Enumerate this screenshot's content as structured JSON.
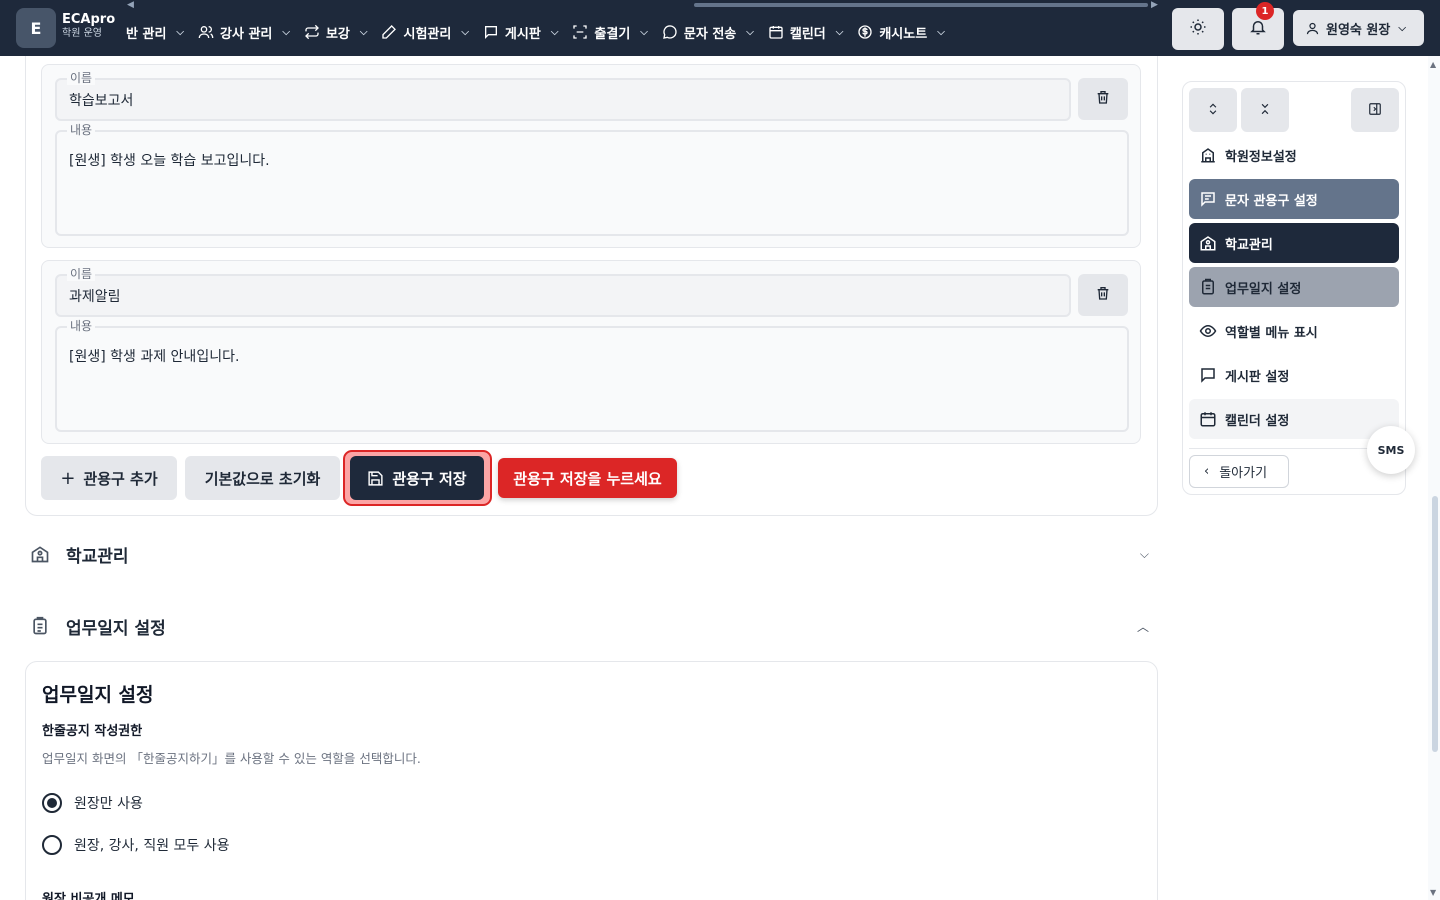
{
  "topbar": {
    "logo_letter": "E",
    "brand_title": "ECApro",
    "brand_sub": "학원 운영",
    "nav": [
      {
        "label": "반 관리",
        "icon": "class-icon"
      },
      {
        "label": "강사 관리",
        "icon": "users-icon"
      },
      {
        "label": "보강",
        "icon": "repeat-icon"
      },
      {
        "label": "시험관리",
        "icon": "pen-icon"
      },
      {
        "label": "게시판",
        "icon": "message-square-icon"
      },
      {
        "label": "출결기",
        "icon": "scan-icon"
      },
      {
        "label": "문자 전송",
        "icon": "message-circle-icon"
      },
      {
        "label": "캘린더",
        "icon": "calendar-icon"
      },
      {
        "label": "캐시노트",
        "icon": "dollar-icon"
      }
    ],
    "notification_count": "1",
    "user_label": "원영숙 원장"
  },
  "templates": [
    {
      "name_legend": "이름",
      "name": "학습보고서",
      "content_legend": "내용",
      "content": "[원생] 학생 오늘 학습 보고입니다."
    },
    {
      "name_legend": "이름",
      "name": "과제알림",
      "content_legend": "내용",
      "content": "[원생] 학생 과제 안내입니다."
    }
  ],
  "actions": {
    "add": "관용구 추가",
    "reset": "기본값으로 초기화",
    "save": "관용구 저장",
    "hint": "관용구 저장을 누르세요"
  },
  "sections": {
    "school": "학교관리",
    "worklog": "업무일지 설정"
  },
  "worklog_card": {
    "title": "업무일지 설정",
    "subtitle": "한줄공지 작성권한",
    "description": "업무일지 화면의 「한줄공지하기」를 사용할 수 있는 역할을 선택합니다.",
    "options": [
      {
        "label": "원장만 사용",
        "selected": true
      },
      {
        "label": "원장, 강사, 직원 모두 사용",
        "selected": false
      }
    ],
    "next_heading": "원장 비공개 메모"
  },
  "panel": {
    "items": [
      {
        "label": "학원정보설정",
        "icon": "building-icon"
      },
      {
        "label": "문자 관용구 설정",
        "icon": "message-text-icon"
      },
      {
        "label": "학교관리",
        "icon": "school-icon"
      },
      {
        "label": "업무일지 설정",
        "icon": "clipboard-icon"
      },
      {
        "label": "역할별 메뉴 표시",
        "icon": "eye-icon"
      },
      {
        "label": "게시판 설정",
        "icon": "message-square-icon"
      },
      {
        "label": "캘린더 설정",
        "icon": "calendar-icon"
      }
    ],
    "back": "돌아가기",
    "sms": "SMS"
  }
}
